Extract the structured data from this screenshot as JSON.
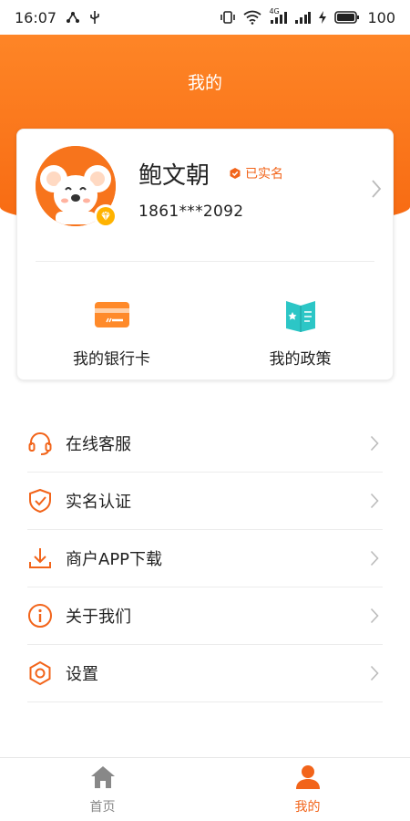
{
  "status_bar": {
    "time": "16:07",
    "signal_tag": "4G",
    "battery": "100"
  },
  "header": {
    "title": "我的"
  },
  "profile": {
    "name": "鲍文朝",
    "verified_label": "已实名",
    "phone": "1861***2092",
    "avatar_icon": "koala-avatar",
    "level_icon": "diamond-icon"
  },
  "quick_links": [
    {
      "label": "我的银行卡",
      "icon": "bank-card-icon"
    },
    {
      "label": "我的政策",
      "icon": "policy-book-icon"
    }
  ],
  "menu": [
    {
      "label": "在线客服",
      "icon": "headset-icon"
    },
    {
      "label": "实名认证",
      "icon": "shield-check-icon"
    },
    {
      "label": "商户APP下载",
      "icon": "download-icon"
    },
    {
      "label": "关于我们",
      "icon": "info-icon"
    },
    {
      "label": "设置",
      "icon": "settings-hex-icon"
    }
  ],
  "tabbar": [
    {
      "label": "首页",
      "icon": "home-icon",
      "active": false
    },
    {
      "label": "我的",
      "icon": "user-icon",
      "active": true
    }
  ],
  "colors": {
    "brand": "#f2641a",
    "accent_gold": "#ffb300",
    "teal": "#2cc6c6"
  }
}
